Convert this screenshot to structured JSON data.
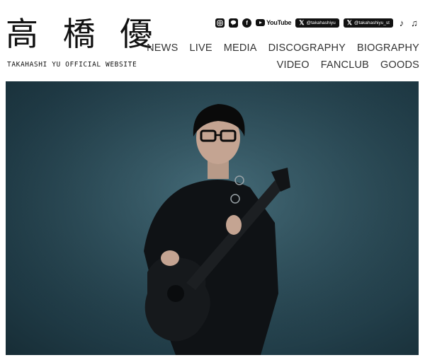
{
  "logo": {
    "kanji": "高 橋 優",
    "subtitle": "TAKAHASHI YU OFFICIAL WEBSITE"
  },
  "socials": {
    "instagram_icon": "instagram-icon",
    "line_icon": "line-icon",
    "facebook_icon": "facebook-icon",
    "youtube_label": "YouTube",
    "x_account_1": "@takahashiyu",
    "x_account_2": "@takahashiyu_st",
    "tiktok_icon": "tiktok-icon",
    "music_icon": "music-icon"
  },
  "nav": {
    "row1": [
      "NEWS",
      "LIVE",
      "MEDIA",
      "DISCOGRAPHY",
      "BIOGRAPHY"
    ],
    "row2": [
      "VIDEO",
      "FANCLUB",
      "GOODS"
    ]
  },
  "colors": {
    "background": "#ffffff",
    "hero_bg": "#2e4f5b",
    "text": "#333333"
  }
}
